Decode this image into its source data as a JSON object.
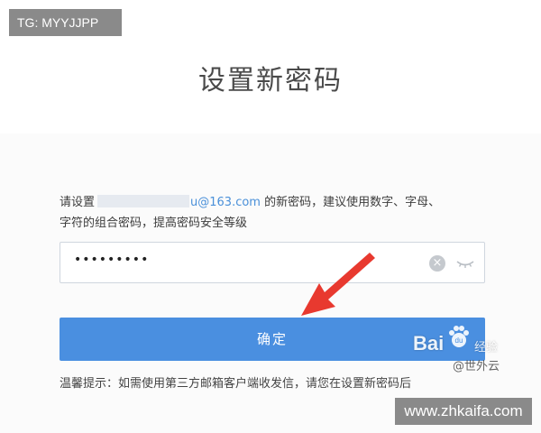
{
  "tg_badge": "TG: MYYJJPP",
  "page_title": "设置新密码",
  "instruction": {
    "prefix": "请设置",
    "email": "u@163.com",
    "suffix_line1": " 的新密码，建议使用数字、字母、",
    "line2": "字符的组合密码，提高密码安全等级"
  },
  "password": {
    "value": "•••••••••"
  },
  "confirm_label": "确定",
  "tip": "温馨提示：如需使用第三方邮箱客户端收发信，请您在设置新密码后",
  "watermark": {
    "baidu": "Bai",
    "baidu_suffix": "经验",
    "author": "@世外云"
  },
  "site_badge": "www.zhkaifa.com",
  "colors": {
    "accent": "#4a8fe0",
    "link": "#4a90d9",
    "arrow": "#e8392f"
  },
  "icons": {
    "clear": "clear-icon",
    "eye": "eye-closed-icon",
    "arrow": "red-arrow-icon"
  }
}
